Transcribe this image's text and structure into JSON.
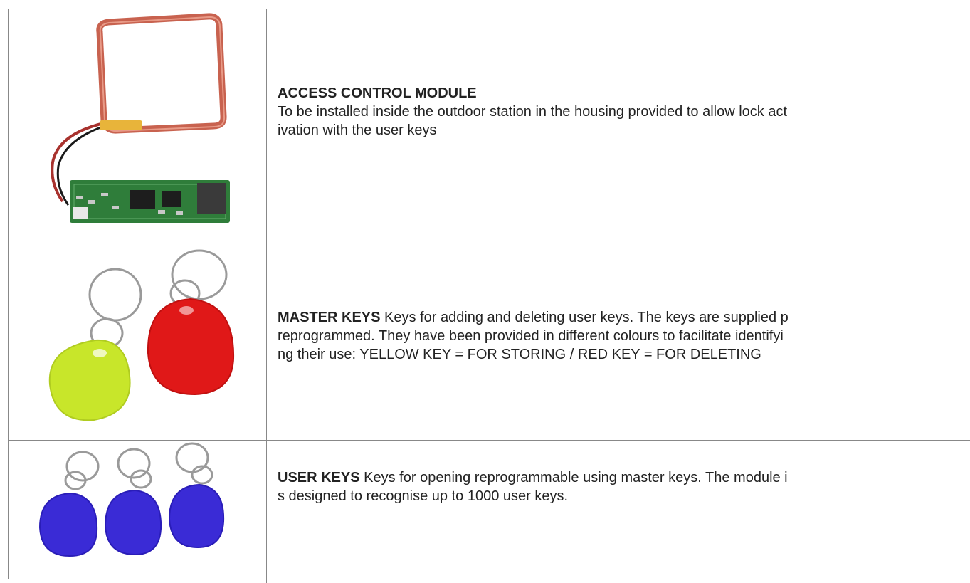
{
  "rows": [
    {
      "image_subject": "rfid-antenna-coil-and-circuit-board",
      "title": "ACCESS CONTROL MODULE",
      "lines": [
        "To be installed inside the outdoor station in the housing provided to allow lock act",
        "ivation with the user keys"
      ]
    },
    {
      "image_subject": "yellow-and-red-key-fobs",
      "title": "MASTER KEYS",
      "line1_rest": " Keys for adding and deleting user keys. The keys are supplied p",
      "lines": [
        "reprogrammed. They have been provided in different colours to facilitate identifyi",
        "ng their use: YELLOW KEY = FOR STORING / RED KEY = FOR DELETING"
      ]
    },
    {
      "image_subject": "three-blue-key-fobs",
      "title": "USER KEYS",
      "line1_rest": " Keys for opening reprogrammable using master keys. The module i",
      "lines": [
        "s designed to recognise up to 1000 user keys."
      ]
    }
  ],
  "colors": {
    "border": "#888888",
    "text": "#222222",
    "coil": "#c8624f",
    "pcb": "#2f7d3a",
    "yellow_fob": "#c8e62a",
    "red_fob": "#e01818",
    "blue_fob": "#3a2bd6"
  }
}
